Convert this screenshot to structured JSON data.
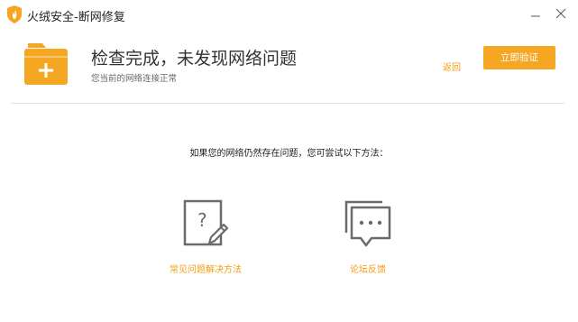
{
  "window": {
    "title": "火绒安全-断网修复",
    "logo_icon": "huorong-shield-icon",
    "minimize_icon": "minimize-icon",
    "close_icon": "close-icon"
  },
  "header": {
    "status_icon": "folder-plus-icon",
    "status_title": "检查完成，未发现网络问题",
    "status_subtitle": "您当前的网络连接正常",
    "back_label": "返回",
    "verify_label": "立即验证"
  },
  "main": {
    "hint": "如果您的网络仍然存在问题，您可尝试以下方法：",
    "options": [
      {
        "label": "常见问题解决方法",
        "icon": "faq-document-icon"
      },
      {
        "label": "论坛反馈",
        "icon": "chat-bubbles-icon"
      }
    ]
  },
  "colors": {
    "accent": "#f5a623",
    "link": "#f39c12",
    "icon_gray": "#6b6b6b",
    "divider": "#e3e3e3"
  }
}
